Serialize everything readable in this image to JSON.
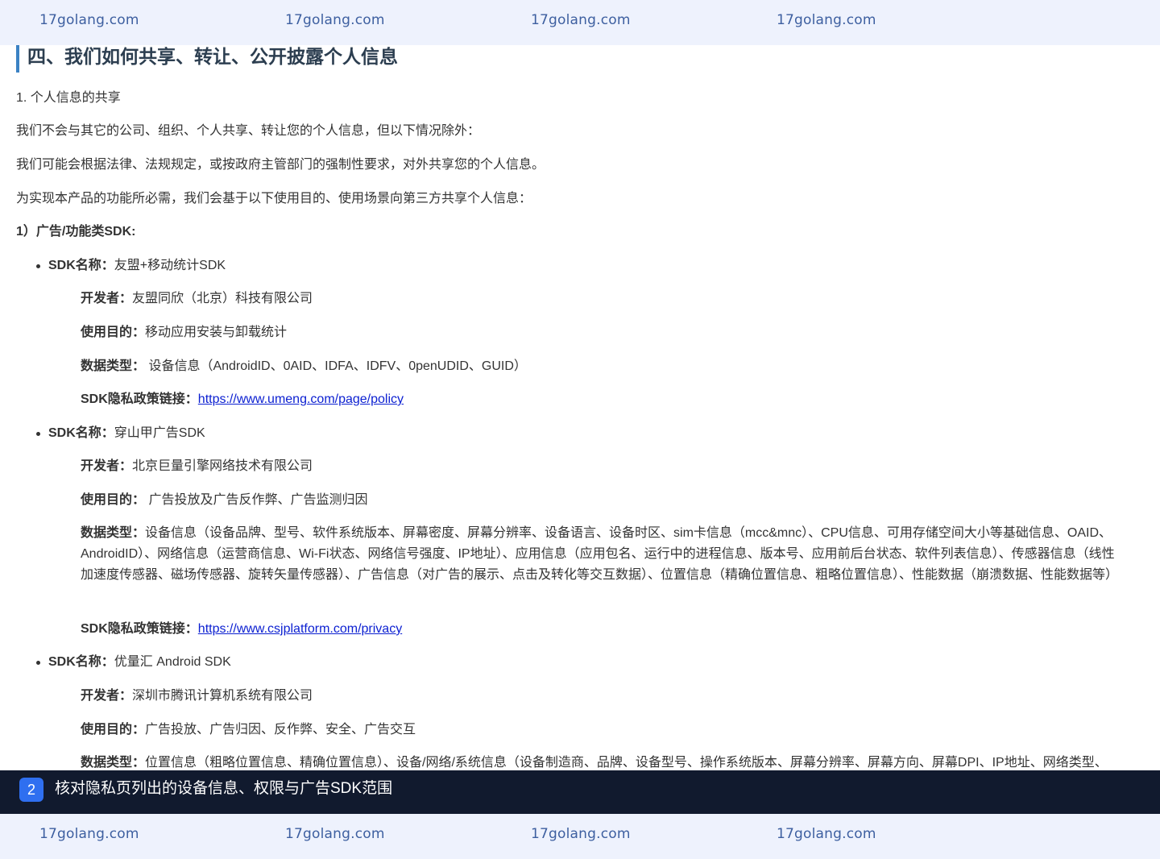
{
  "watermark": {
    "text": "17golang.com"
  },
  "section": {
    "heading": "四、我们如何共享、转让、公开披露个人信息",
    "sub_heading": "1. 个人信息的共享",
    "para1": "我们不会与其它的公司、组织、个人共享、转让您的个人信息，但以下情况除外：",
    "para2": "我们可能会根据法律、法规规定，或按政府主管部门的强制性要求，对外共享您的个人信息。",
    "para3": "为实现本产品的功能所必需，我们会基于以下使用目的、使用场景向第三方共享个人信息：",
    "category": "1）广告/功能类SDK:"
  },
  "labels": {
    "sdk_name": "SDK名称：",
    "developer": "开发者：",
    "purpose": "使用目的：",
    "data_type": "数据类型：",
    "policy_link": "SDK隐私政策链接："
  },
  "sdks": [
    {
      "name": "友盟+移动统计SDK",
      "developer": "友盟同欣（北京）科技有限公司",
      "purpose": "移动应用安装与卸载统计",
      "data_type": " 设备信息（AndroidID、0AID、IDFA、IDFV、0penUDID、GUID）",
      "policy_url": "https://www.umeng.com/page/policy"
    },
    {
      "name": "穿山甲广告SDK",
      "developer": "北京巨量引擎网络技术有限公司",
      "purpose": " 广告投放及广告反作弊、广告监测归因",
      "data_type": "设备信息（设备品牌、型号、软件系统版本、屏幕密度、屏幕分辨率、设备语言、设备时区、sim卡信息（mcc&mnc）、CPU信息、可用存储空间大小等基础信息、OAID、AndroidID）、网络信息（运营商信息、Wi-Fi状态、网络信号强度、IP地址）、应用信息（应用包名、运行中的进程信息、版本号、应用前后台状态、软件列表信息）、传感器信息（线性加速度传感器、磁场传感器、旋转矢量传感器）、广告信息（对广告的展示、点击及转化等交互数据）、位置信息（精确位置信息、粗略位置信息）、性能数据（崩溃数据、性能数据等）",
      "policy_url": "https://www.csjplatform.com/privacy"
    },
    {
      "name": "优量汇 Android SDK",
      "developer": "深圳市腾讯计算机系统有限公司",
      "purpose": "广告投放、广告归因、反作弊、安全、广告交互",
      "data_type": "位置信息（粗略位置信息、精确位置信息）、设备/网络/系统信息（设备制造商、品牌、设备型号、操作系统版本、屏幕分辨率、屏幕方向、屏幕DPI、IP地址、网络类型、"
    }
  ],
  "banner": {
    "step": "2",
    "text": "核对隐私页列出的设备信息、权限与广告SDK范围"
  }
}
